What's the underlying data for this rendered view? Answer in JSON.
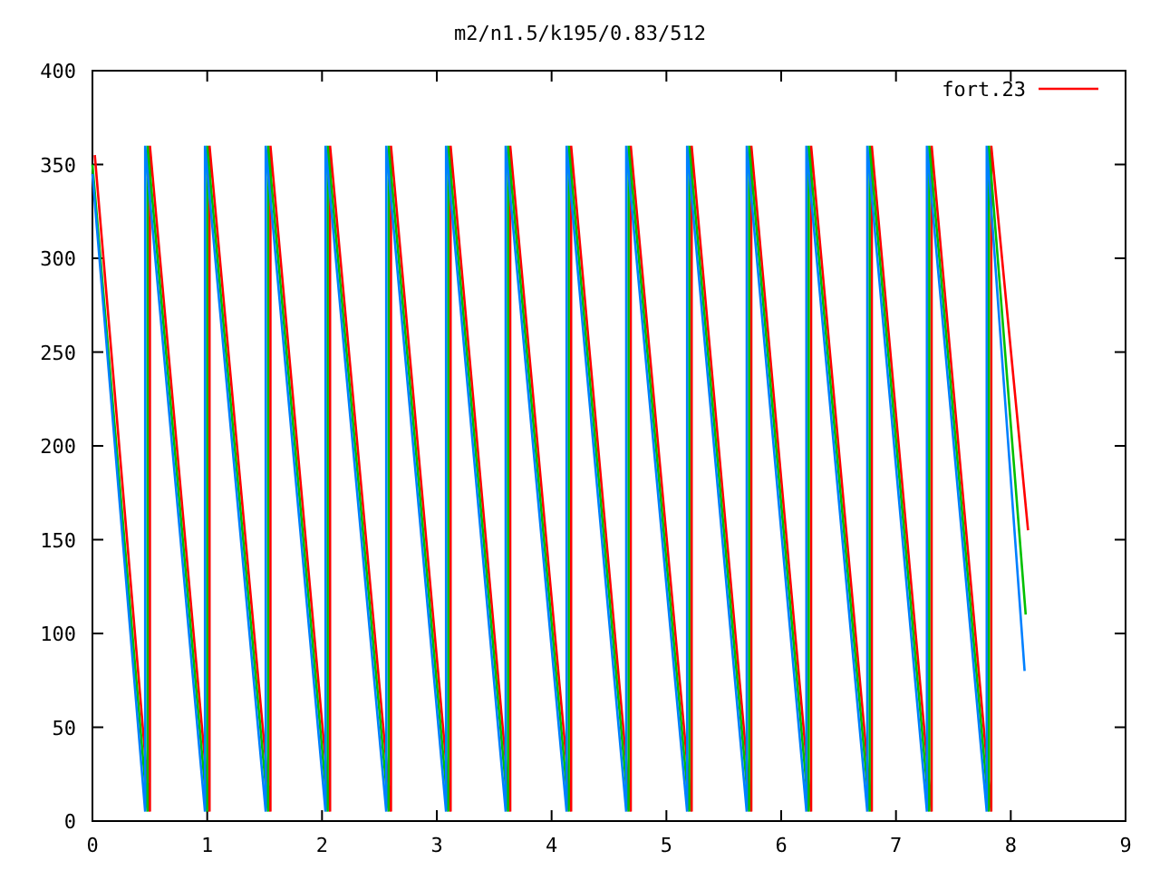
{
  "chart": {
    "chart_data": {
      "type": "line",
      "title": "m2/n1.5/k195/0.83/512",
      "xlim": [
        0,
        9
      ],
      "ylim": [
        0,
        400
      ],
      "xticks": [
        0,
        1,
        2,
        3,
        4,
        5,
        6,
        7,
        8,
        9
      ],
      "yticks": [
        0,
        50,
        100,
        150,
        200,
        250,
        300,
        350,
        400
      ],
      "series": [
        {
          "name": "fort.23",
          "color": "#ff0000",
          "x": [
            0.02,
            0.5,
            0.5,
            1.02,
            1.02,
            1.55,
            1.55,
            2.07,
            2.07,
            2.6,
            2.6,
            3.12,
            3.12,
            3.64,
            3.64,
            4.17,
            4.17,
            4.69,
            4.69,
            5.22,
            5.22,
            5.74,
            5.74,
            6.26,
            6.26,
            6.79,
            6.79,
            7.31,
            7.31,
            7.83,
            7.83,
            8.15
          ],
          "values": [
            355,
            5,
            360,
            5,
            360,
            5,
            360,
            5,
            360,
            5,
            360,
            5,
            360,
            5,
            360,
            5,
            360,
            5,
            360,
            5,
            360,
            5,
            360,
            5,
            360,
            5,
            360,
            5,
            360,
            5,
            360,
            155
          ]
        },
        {
          "color": "#00c000",
          "x": [
            0.0,
            0.48,
            0.48,
            1.0,
            1.0,
            1.53,
            1.53,
            2.05,
            2.05,
            2.58,
            2.58,
            3.1,
            3.1,
            3.62,
            3.62,
            4.15,
            4.15,
            4.67,
            4.67,
            5.2,
            5.2,
            5.72,
            5.72,
            6.24,
            6.24,
            6.77,
            6.77,
            7.29,
            7.29,
            7.81,
            7.81,
            8.13
          ],
          "values": [
            350,
            5,
            360,
            5,
            360,
            5,
            360,
            5,
            360,
            5,
            360,
            5,
            360,
            5,
            360,
            5,
            360,
            5,
            360,
            5,
            360,
            5,
            360,
            5,
            360,
            5,
            360,
            5,
            360,
            5,
            360,
            110
          ]
        },
        {
          "color": "#0080ff",
          "x": [
            0.0,
            0.46,
            0.46,
            0.98,
            0.98,
            1.51,
            1.51,
            2.03,
            2.03,
            2.56,
            2.56,
            3.08,
            3.08,
            3.6,
            3.6,
            4.13,
            4.13,
            4.65,
            4.65,
            5.18,
            5.18,
            5.7,
            5.7,
            6.22,
            6.22,
            6.75,
            6.75,
            7.27,
            7.27,
            7.79,
            7.79,
            8.12
          ],
          "values": [
            345,
            5,
            360,
            5,
            360,
            5,
            360,
            5,
            360,
            5,
            360,
            5,
            360,
            5,
            360,
            5,
            360,
            5,
            360,
            5,
            360,
            5,
            360,
            5,
            360,
            5,
            360,
            5,
            360,
            5,
            360,
            80
          ]
        }
      ]
    }
  }
}
